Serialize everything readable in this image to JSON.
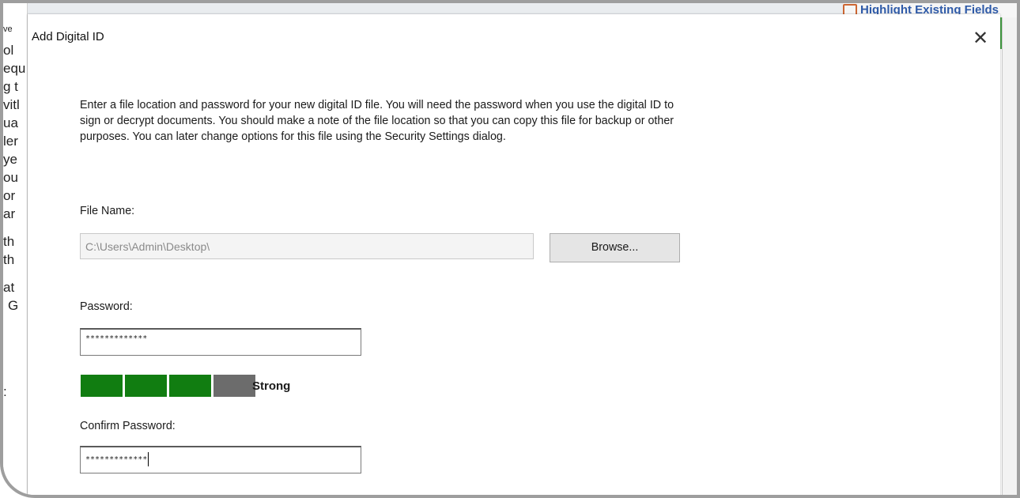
{
  "background_app": {
    "left_fragments": [
      "ve",
      "ol",
      "equ",
      "g t",
      "vitl",
      "ua",
      "ler",
      "ye",
      "ou",
      "or",
      "ar",
      "th",
      "th",
      "at",
      "G",
      ":"
    ],
    "highlight_button_label": "Highlight Existing Fields"
  },
  "dialog": {
    "title": "Add Digital ID",
    "close_glyph": "✕",
    "instructions": "Enter a file location and password for your new digital ID file. You will need the password when you use the digital ID to sign or decrypt documents. You should make a note of the file location so that you can copy this file for backup or other purposes. You can later change options for this file using the Security Settings dialog.",
    "file_name": {
      "label": "File Name:",
      "value": "C:\\Users\\Admin\\Desktop\\"
    },
    "browse_label": "Browse...",
    "password": {
      "label": "Password:",
      "value": "*************"
    },
    "strength": {
      "filled_segments": 3,
      "total_segments": 4,
      "label": "Strong",
      "on_color": "#117d11",
      "off_color": "#6c6c6c"
    },
    "confirm_password": {
      "label": "Confirm Password:",
      "value": "*************"
    }
  }
}
